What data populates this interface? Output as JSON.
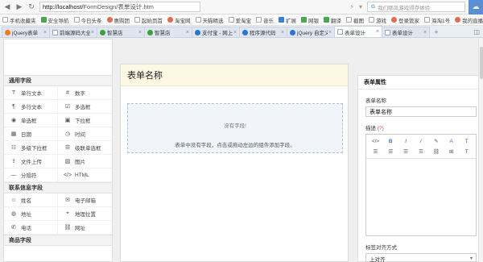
{
  "browser": {
    "url_host": "http://localhost/",
    "url_path": "FormDesign/表单设计.htm",
    "search_placeholder": "我们哪风游戏得存体验",
    "search_engine": "G",
    "bookmarks": [
      {
        "label": "手机收藏夹",
        "type": "doc"
      },
      {
        "label": "安全导航",
        "type": "g"
      },
      {
        "label": "今日头条",
        "type": "doc"
      },
      {
        "label": "惠购团",
        "type": "c"
      },
      {
        "label": "起始页首",
        "type": "doc"
      },
      {
        "label": "淘宝网",
        "type": "c"
      },
      {
        "label": "天猫精选",
        "type": "doc"
      },
      {
        "label": "爱淘宝",
        "type": "doc"
      },
      {
        "label": "音乐",
        "type": "doc"
      },
      {
        "label": "扩展",
        "type": "t"
      },
      {
        "label": "网银",
        "type": "g"
      },
      {
        "label": "翻译",
        "type": "g"
      },
      {
        "label": "截图",
        "type": "doc"
      },
      {
        "label": "游戏",
        "type": "doc"
      },
      {
        "label": "登录管家",
        "type": "c"
      },
      {
        "label": "海淘1号",
        "type": "doc"
      },
      {
        "label": "我的直播",
        "type": "c"
      }
    ],
    "tabs": [
      {
        "label": "jQuery表单",
        "icon": "orange",
        "active": false
      },
      {
        "label": "前端源码大全",
        "icon": "doc",
        "active": false
      },
      {
        "label": "智慧店",
        "icon": "green",
        "active": false
      },
      {
        "label": "智慧店",
        "icon": "green",
        "active": false
      },
      {
        "label": "支付宝 - 网上",
        "icon": "blue",
        "active": false
      },
      {
        "label": "程序源代码",
        "icon": "blue",
        "active": false
      },
      {
        "label": "jQuery 自定义",
        "icon": "blue",
        "active": false
      },
      {
        "label": "表单设计",
        "icon": "doc",
        "active": true
      },
      {
        "label": "表单设计",
        "icon": "doc",
        "active": false
      }
    ]
  },
  "left": {
    "groups": [
      {
        "title": "通用字段",
        "items": [
          {
            "label": "单行文本",
            "icon": "T"
          },
          {
            "label": "数字",
            "icon": "#"
          },
          {
            "label": "多行文本",
            "icon": "¶"
          },
          {
            "label": "多选框",
            "icon": "☑"
          },
          {
            "label": "单选框",
            "icon": "◉"
          },
          {
            "label": "下拉框",
            "icon": "▣"
          },
          {
            "label": "日期",
            "icon": "▦"
          },
          {
            "label": "时间",
            "icon": "◷"
          },
          {
            "label": "多级下拉框",
            "icon": "☷"
          },
          {
            "label": "级联单选框",
            "icon": "☰"
          },
          {
            "label": "文件上传",
            "icon": "⇪"
          },
          {
            "label": "图片",
            "icon": "▨"
          },
          {
            "label": "分隔符",
            "icon": "—"
          },
          {
            "label": "HTML",
            "icon": "</>"
          }
        ]
      },
      {
        "title": "联系信息字段",
        "items": [
          {
            "label": "姓名",
            "icon": "☺"
          },
          {
            "label": "电子邮箱",
            "icon": "✉"
          },
          {
            "label": "地址",
            "icon": "◍"
          },
          {
            "label": "地理位置",
            "icon": "⌖"
          },
          {
            "label": "电话",
            "icon": "✆"
          },
          {
            "label": "网址",
            "icon": "⛓"
          }
        ]
      },
      {
        "title": "商品字段",
        "items": []
      }
    ]
  },
  "center": {
    "form_title": "表单名称",
    "empty_title": "没有字段!",
    "empty_hint": "表单中没有字段，点击或拖动左边的组件添加字段。"
  },
  "right": {
    "panel_title": "表单属性",
    "name_label": "表单名称",
    "name_value": "表单名称",
    "desc_label": "描述",
    "desc_hint": "(?)",
    "toolbar": [
      "</>",
      "B",
      "I",
      "⁄",
      "✎",
      "A",
      "T",
      "☰",
      "☰",
      "☰",
      "☰",
      "⛓",
      "⊞",
      "T"
    ],
    "align_label": "标签对齐方式",
    "align_value": "上对齐"
  }
}
